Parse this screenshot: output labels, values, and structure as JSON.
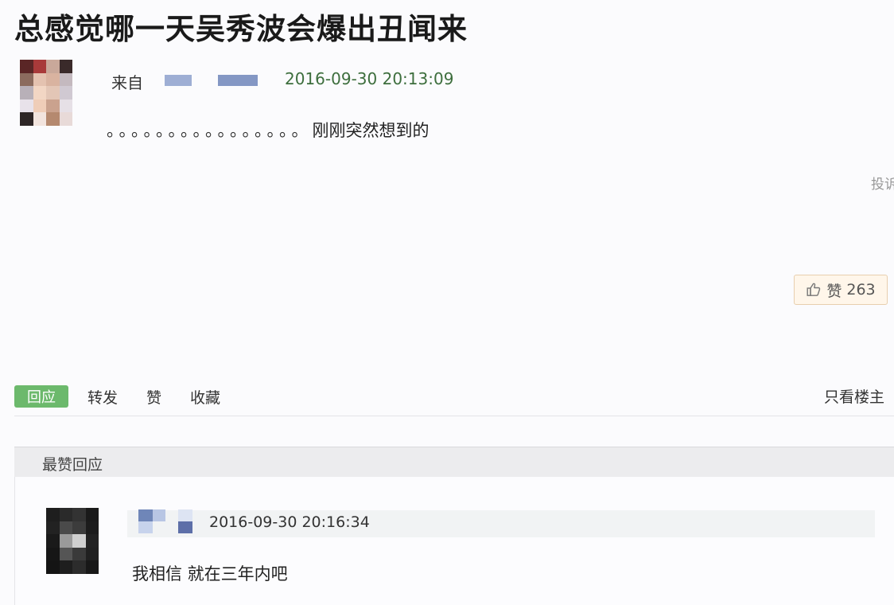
{
  "post": {
    "title": "总感觉哪一天吴秀波会爆出丑闻来",
    "from_label": "来自",
    "timestamp": "2016-09-30 20:13:09",
    "body_dots": "。。。。。。。。。。。。。。。。",
    "body_text": "刚刚突然想到的",
    "report_label": "投诉",
    "like_label": "赞",
    "like_count": "263"
  },
  "actions": {
    "reply": "回应",
    "forward": "转发",
    "like": "赞",
    "collect": "收藏",
    "only_op": "只看楼主"
  },
  "best_replies": {
    "header": "最赞回应",
    "items": [
      {
        "timestamp": "2016-09-30 20:16:34",
        "text": "我相信 就在三年内吧"
      }
    ]
  },
  "icons": {
    "like": "thumbs-up-icon"
  },
  "colors": {
    "reply_button": "#6cb96c",
    "timestamp_main": "#3d6e3d",
    "like_bg": "#fff6ea"
  }
}
